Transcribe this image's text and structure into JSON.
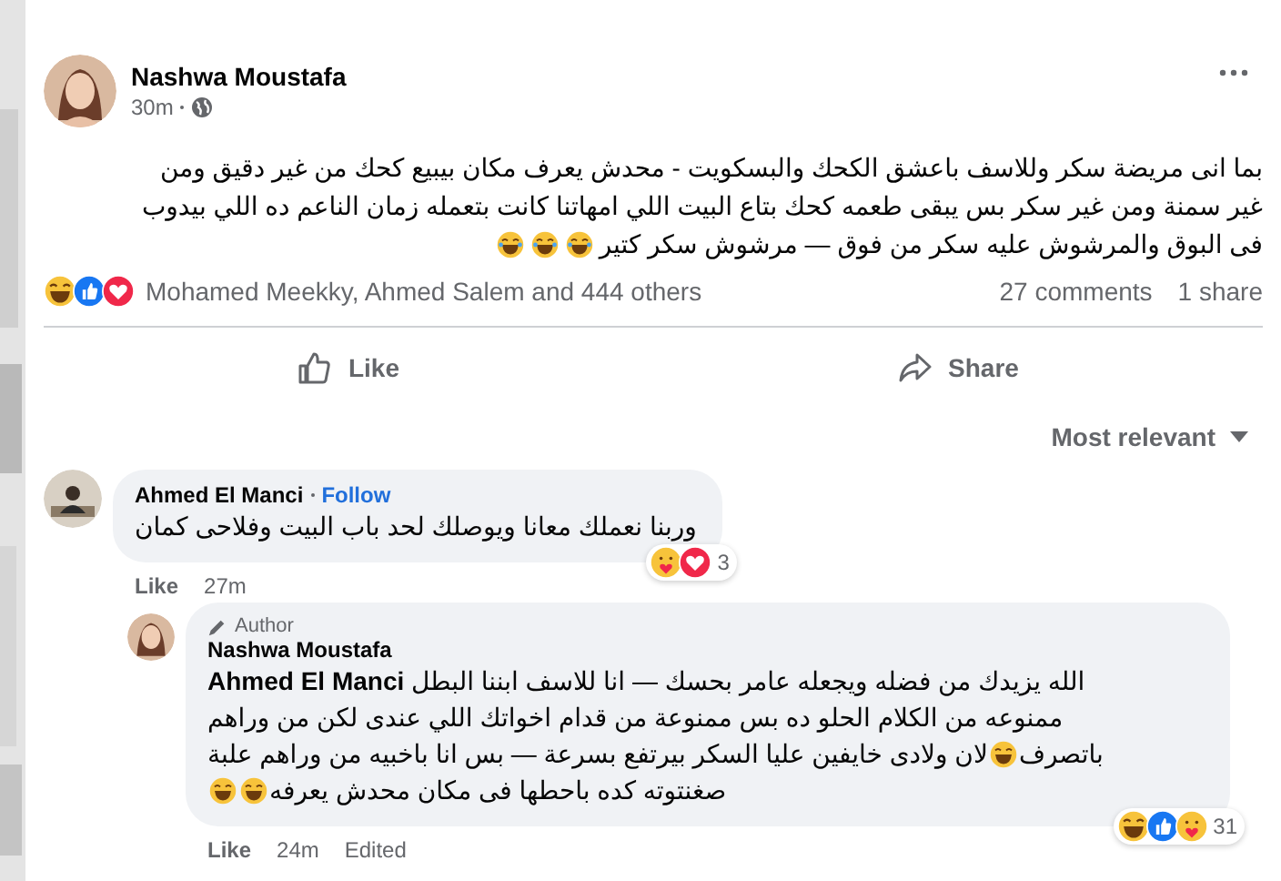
{
  "post": {
    "author": "Nashwa Moustafa",
    "time": "30m",
    "lines": [
      [
        {
          "kind": "text",
          "text": "بما انى مريضة سكر وللاسف باعشق الكحك والبسكويت -  محدش يعرف مكان بيبيع كحك من غير دقيق ومن"
        }
      ],
      [
        {
          "kind": "text",
          "text": "غير سمنة ومن غير سكر  بس يبقى طعمه كحك بتاع البيت اللي امهاتنا كانت بتعمله زمان  الناعم ده اللي بيدوب"
        }
      ],
      [
        {
          "kind": "text",
          "text": "فى البوق والمرشوش عليه سكر من فوق —  مرشوش سكر كتير"
        },
        {
          "kind": "laugh"
        },
        {
          "kind": "laugh"
        },
        {
          "kind": "laugh"
        }
      ]
    ],
    "reactions": [
      {
        "kind": "haha"
      },
      {
        "kind": "like"
      },
      {
        "kind": "love"
      }
    ],
    "reacted_by": "Mohamed Meekky, Ahmed Salem and 444 others",
    "comments": "27 comments",
    "shares": "1 share"
  },
  "like_action": "Like",
  "share_action": "Share",
  "sort": "Most relevant",
  "comments": [
    {
      "author": "Ahmed El Manci",
      "follow": "Follow",
      "lines": [
        [
          {
            "kind": "text",
            "text": "وربنا نعملك معانا ويوصلك لحد باب البيت وفلاحى كمان"
          }
        ]
      ],
      "reactions": [
        {
          "kind": "care"
        },
        {
          "kind": "love"
        }
      ],
      "reaction_count": "3",
      "like": "Like",
      "time": "27m",
      "replies": [
        {
          "badge": "Author",
          "author": "Nashwa Moustafa",
          "lines": [
            [
              {
                "kind": "text",
                "text": "**Ahmed El Manci** الله يزيدك من فضله ويجعله عامر بحسك — انا للاسف ابننا البطل"
              }
            ],
            [
              {
                "kind": "text",
                "text": "ممنوعه من الكلام الحلو ده بس ممنوعة من قدام اخواتك اللي عندى لكن من وراهم"
              }
            ],
            [
              {
                "kind": "text",
                "text": "باتصرف "
              },
              {
                "kind": "laugh"
              },
              {
                "kind": "text",
                "text": "لان ولادى خايفين عليا السكر بيرتفع بسرعة — بس انا باخبيه من وراهم علبة"
              }
            ],
            [
              {
                "kind": "text",
                "text": "صغنتوته كده باحطها فى مكان محدش يعرفه"
              },
              {
                "kind": "laugh"
              },
              {
                "kind": "laugh"
              }
            ]
          ],
          "reactions": [
            {
              "kind": "haha"
            },
            {
              "kind": "like"
            },
            {
              "kind": "care"
            }
          ],
          "reaction_count": "31",
          "like": "Like",
          "time": "24m",
          "edited": "Edited"
        }
      ]
    }
  ]
}
